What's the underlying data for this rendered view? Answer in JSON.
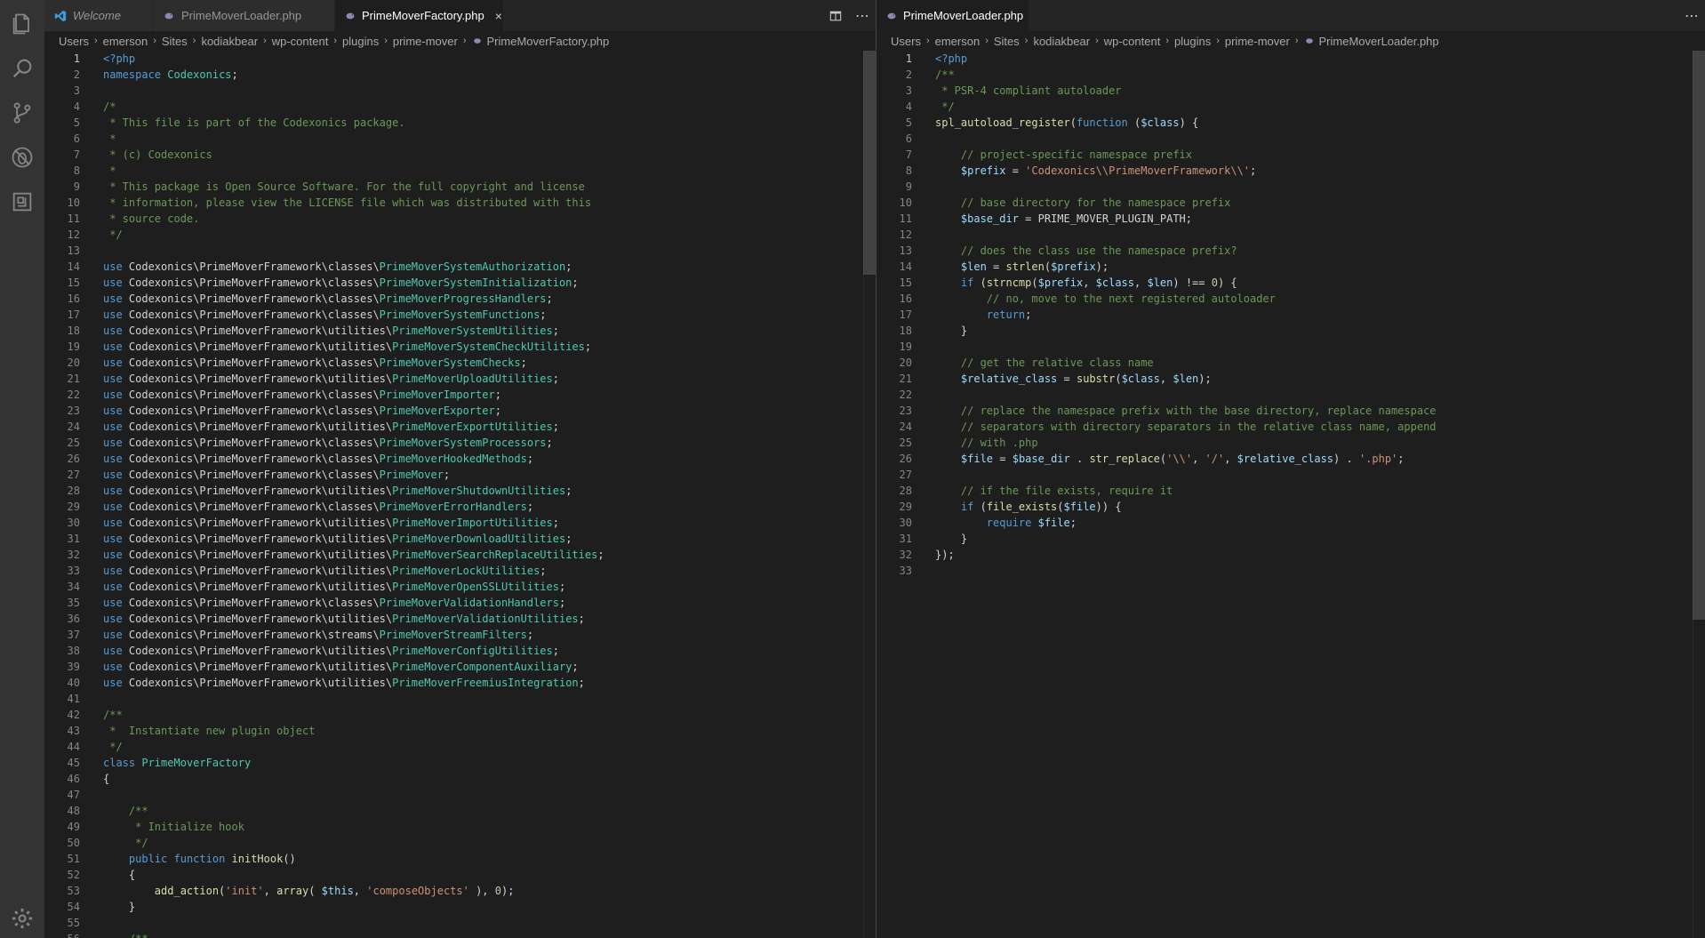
{
  "activity_bar": {
    "items": [
      "explorer-icon",
      "search-icon",
      "source-control-icon",
      "debug-icon",
      "extensions-icon"
    ],
    "bottom": "settings-gear-icon"
  },
  "left_group": {
    "tabs": [
      {
        "label": "Welcome",
        "icon": "vscode-icon",
        "active": false,
        "italic": true
      },
      {
        "label": "PrimeMoverLoader.php",
        "icon": "php-elephant-icon",
        "active": false
      },
      {
        "label": "PrimeMoverFactory.php",
        "icon": "php-elephant-icon",
        "active": true,
        "close": "×"
      }
    ],
    "actions": [
      "split-editor-icon",
      "more-actions-icon"
    ],
    "breadcrumb": [
      "Users",
      "emerson",
      "Sites",
      "kodiakbear",
      "wp-content",
      "plugins",
      "prime-mover",
      "PrimeMoverFactory.php"
    ],
    "current_line": 1
  },
  "right_group": {
    "tabs": [
      {
        "label": "PrimeMoverLoader.php",
        "icon": "php-elephant-icon",
        "active": true,
        "close": "×"
      }
    ],
    "actions": [
      "more-actions-icon"
    ],
    "breadcrumb": [
      "Users",
      "emerson",
      "Sites",
      "kodiakbear",
      "wp-content",
      "plugins",
      "prime-mover",
      "PrimeMoverLoader.php"
    ],
    "current_line": 1
  },
  "colors": {
    "keyword": "#569cd6",
    "comment": "#6a9955",
    "string": "#ce9178",
    "class": "#4ec9b0",
    "variable": "#9cdcfe",
    "function": "#dcdcaa"
  },
  "left_code": [
    [
      [
        "kw",
        "<?php"
      ]
    ],
    [
      [
        "kw",
        "namespace"
      ],
      [
        "",
        "",
        " "
      ],
      [
        "cls",
        "Codexonics"
      ],
      [
        "",
        ";"
      ]
    ],
    [],
    [
      [
        "cm",
        "/*"
      ]
    ],
    [
      [
        "cm",
        " * This file is part of the Codexonics package."
      ]
    ],
    [
      [
        "cm",
        " *"
      ]
    ],
    [
      [
        "cm",
        " * (c) Codexonics"
      ]
    ],
    [
      [
        "cm",
        " *"
      ]
    ],
    [
      [
        "cm",
        " * This package is Open Source Software. For the full copyright and license"
      ]
    ],
    [
      [
        "cm",
        " * information, please view the LICENSE file which was distributed with this"
      ]
    ],
    [
      [
        "cm",
        " * source code."
      ]
    ],
    [
      [
        "cm",
        " */"
      ]
    ],
    [],
    [
      [
        "kw",
        "use"
      ],
      [
        "",
        " Codexonics\\PrimeMoverFramework\\classes\\"
      ],
      [
        "cls",
        "PrimeMoverSystemAuthorization"
      ],
      [
        "",
        ";"
      ]
    ],
    [
      [
        "kw",
        "use"
      ],
      [
        "",
        " Codexonics\\PrimeMoverFramework\\classes\\"
      ],
      [
        "cls",
        "PrimeMoverSystemInitialization"
      ],
      [
        "",
        ";"
      ]
    ],
    [
      [
        "kw",
        "use"
      ],
      [
        "",
        " Codexonics\\PrimeMoverFramework\\classes\\"
      ],
      [
        "cls",
        "PrimeMoverProgressHandlers"
      ],
      [
        "",
        ";"
      ]
    ],
    [
      [
        "kw",
        "use"
      ],
      [
        "",
        " Codexonics\\PrimeMoverFramework\\classes\\"
      ],
      [
        "cls",
        "PrimeMoverSystemFunctions"
      ],
      [
        "",
        ";"
      ]
    ],
    [
      [
        "kw",
        "use"
      ],
      [
        "",
        " Codexonics\\PrimeMoverFramework\\utilities\\"
      ],
      [
        "cls",
        "PrimeMoverSystemUtilities"
      ],
      [
        "",
        ";"
      ]
    ],
    [
      [
        "kw",
        "use"
      ],
      [
        "",
        " Codexonics\\PrimeMoverFramework\\utilities\\"
      ],
      [
        "cls",
        "PrimeMoverSystemCheckUtilities"
      ],
      [
        "",
        ";"
      ]
    ],
    [
      [
        "kw",
        "use"
      ],
      [
        "",
        " Codexonics\\PrimeMoverFramework\\classes\\"
      ],
      [
        "cls",
        "PrimeMoverSystemChecks"
      ],
      [
        "",
        ";"
      ]
    ],
    [
      [
        "kw",
        "use"
      ],
      [
        "",
        " Codexonics\\PrimeMoverFramework\\utilities\\"
      ],
      [
        "cls",
        "PrimeMoverUploadUtilities"
      ],
      [
        "",
        ";"
      ]
    ],
    [
      [
        "kw",
        "use"
      ],
      [
        "",
        " Codexonics\\PrimeMoverFramework\\classes\\"
      ],
      [
        "cls",
        "PrimeMoverImporter"
      ],
      [
        "",
        ";"
      ]
    ],
    [
      [
        "kw",
        "use"
      ],
      [
        "",
        " Codexonics\\PrimeMoverFramework\\classes\\"
      ],
      [
        "cls",
        "PrimeMoverExporter"
      ],
      [
        "",
        ";"
      ]
    ],
    [
      [
        "kw",
        "use"
      ],
      [
        "",
        " Codexonics\\PrimeMoverFramework\\utilities\\"
      ],
      [
        "cls",
        "PrimeMoverExportUtilities"
      ],
      [
        "",
        ";"
      ]
    ],
    [
      [
        "kw",
        "use"
      ],
      [
        "",
        " Codexonics\\PrimeMoverFramework\\classes\\"
      ],
      [
        "cls",
        "PrimeMoverSystemProcessors"
      ],
      [
        "",
        ";"
      ]
    ],
    [
      [
        "kw",
        "use"
      ],
      [
        "",
        " Codexonics\\PrimeMoverFramework\\classes\\"
      ],
      [
        "cls",
        "PrimeMoverHookedMethods"
      ],
      [
        "",
        ";"
      ]
    ],
    [
      [
        "kw",
        "use"
      ],
      [
        "",
        " Codexonics\\PrimeMoverFramework\\classes\\"
      ],
      [
        "cls",
        "PrimeMover"
      ],
      [
        "",
        ";"
      ]
    ],
    [
      [
        "kw",
        "use"
      ],
      [
        "",
        " Codexonics\\PrimeMoverFramework\\utilities\\"
      ],
      [
        "cls",
        "PrimeMoverShutdownUtilities"
      ],
      [
        "",
        ";"
      ]
    ],
    [
      [
        "kw",
        "use"
      ],
      [
        "",
        " Codexonics\\PrimeMoverFramework\\classes\\"
      ],
      [
        "cls",
        "PrimeMoverErrorHandlers"
      ],
      [
        "",
        ";"
      ]
    ],
    [
      [
        "kw",
        "use"
      ],
      [
        "",
        " Codexonics\\PrimeMoverFramework\\utilities\\"
      ],
      [
        "cls",
        "PrimeMoverImportUtilities"
      ],
      [
        "",
        ";"
      ]
    ],
    [
      [
        "kw",
        "use"
      ],
      [
        "",
        " Codexonics\\PrimeMoverFramework\\utilities\\"
      ],
      [
        "cls",
        "PrimeMoverDownloadUtilities"
      ],
      [
        "",
        ";"
      ]
    ],
    [
      [
        "kw",
        "use"
      ],
      [
        "",
        " Codexonics\\PrimeMoverFramework\\utilities\\"
      ],
      [
        "cls",
        "PrimeMoverSearchReplaceUtilities"
      ],
      [
        "",
        ";"
      ]
    ],
    [
      [
        "kw",
        "use"
      ],
      [
        "",
        " Codexonics\\PrimeMoverFramework\\utilities\\"
      ],
      [
        "cls",
        "PrimeMoverLockUtilities"
      ],
      [
        "",
        ";"
      ]
    ],
    [
      [
        "kw",
        "use"
      ],
      [
        "",
        " Codexonics\\PrimeMoverFramework\\utilities\\"
      ],
      [
        "cls",
        "PrimeMoverOpenSSLUtilities"
      ],
      [
        "",
        ";"
      ]
    ],
    [
      [
        "kw",
        "use"
      ],
      [
        "",
        " Codexonics\\PrimeMoverFramework\\classes\\"
      ],
      [
        "cls",
        "PrimeMoverValidationHandlers"
      ],
      [
        "",
        ";"
      ]
    ],
    [
      [
        "kw",
        "use"
      ],
      [
        "",
        " Codexonics\\PrimeMoverFramework\\utilities\\"
      ],
      [
        "cls",
        "PrimeMoverValidationUtilities"
      ],
      [
        "",
        ";"
      ]
    ],
    [
      [
        "kw",
        "use"
      ],
      [
        "",
        " Codexonics\\PrimeMoverFramework\\streams\\"
      ],
      [
        "cls",
        "PrimeMoverStreamFilters"
      ],
      [
        "",
        ";"
      ]
    ],
    [
      [
        "kw",
        "use"
      ],
      [
        "",
        " Codexonics\\PrimeMoverFramework\\utilities\\"
      ],
      [
        "cls",
        "PrimeMoverConfigUtilities"
      ],
      [
        "",
        ";"
      ]
    ],
    [
      [
        "kw",
        "use"
      ],
      [
        "",
        " Codexonics\\PrimeMoverFramework\\utilities\\"
      ],
      [
        "cls",
        "PrimeMoverComponentAuxiliary"
      ],
      [
        "",
        ";"
      ]
    ],
    [
      [
        "kw",
        "use"
      ],
      [
        "",
        " Codexonics\\PrimeMoverFramework\\utilities\\"
      ],
      [
        "cls",
        "PrimeMoverFreemiusIntegration"
      ],
      [
        "",
        ";"
      ]
    ],
    [],
    [
      [
        "cm",
        "/**"
      ]
    ],
    [
      [
        "cm",
        " *  Instantiate new plugin object"
      ]
    ],
    [
      [
        "cm",
        " */"
      ]
    ],
    [
      [
        "kw",
        "class"
      ],
      [
        "",
        " "
      ],
      [
        "cls",
        "PrimeMoverFactory"
      ]
    ],
    [
      [
        "",
        "{"
      ]
    ],
    [],
    [
      [
        "",
        "    "
      ],
      [
        "cm",
        "/**"
      ]
    ],
    [
      [
        "",
        "    "
      ],
      [
        "cm",
        " * Initialize hook"
      ]
    ],
    [
      [
        "",
        "    "
      ],
      [
        "cm",
        " */"
      ]
    ],
    [
      [
        "",
        "    "
      ],
      [
        "kw",
        "public"
      ],
      [
        "",
        " "
      ],
      [
        "kw",
        "function"
      ],
      [
        "",
        " "
      ],
      [
        "fn",
        "initHook"
      ],
      [
        "",
        "()"
      ]
    ],
    [
      [
        "",
        "    {"
      ]
    ],
    [
      [
        "",
        "        "
      ],
      [
        "fn",
        "add_action"
      ],
      [
        "",
        "("
      ],
      [
        "st",
        "'init'"
      ],
      [
        "",
        ", "
      ],
      [
        "fn",
        "array"
      ],
      [
        "",
        "( "
      ],
      [
        "var",
        "$this"
      ],
      [
        "",
        ", "
      ],
      [
        "st",
        "'composeObjects'"
      ],
      [
        "",
        " ), "
      ],
      [
        "num",
        "0"
      ],
      [
        "",
        ");"
      ]
    ],
    [
      [
        "",
        "    }"
      ]
    ],
    [],
    [
      [
        "",
        "    "
      ],
      [
        "cm",
        "/**"
      ]
    ]
  ],
  "right_code": [
    [
      [
        "kw",
        "<?php"
      ]
    ],
    [
      [
        "cm",
        "/**"
      ]
    ],
    [
      [
        "cm",
        " * PSR-4 compliant autoloader"
      ]
    ],
    [
      [
        "cm",
        " */"
      ]
    ],
    [
      [
        "fn",
        "spl_autoload_register"
      ],
      [
        "",
        "("
      ],
      [
        "kw",
        "function"
      ],
      [
        "",
        " ("
      ],
      [
        "var",
        "$class"
      ],
      [
        "",
        ") {"
      ]
    ],
    [],
    [
      [
        "",
        "    "
      ],
      [
        "cm",
        "// project-specific namespace prefix"
      ]
    ],
    [
      [
        "",
        "    "
      ],
      [
        "var",
        "$prefix"
      ],
      [
        "",
        " = "
      ],
      [
        "st",
        "'Codexonics\\\\PrimeMoverFramework\\\\'"
      ],
      [
        "",
        ";"
      ]
    ],
    [],
    [
      [
        "",
        "    "
      ],
      [
        "cm",
        "// base directory for the namespace prefix"
      ]
    ],
    [
      [
        "",
        "    "
      ],
      [
        "var",
        "$base_dir"
      ],
      [
        "",
        " = PRIME_MOVER_PLUGIN_PATH;"
      ]
    ],
    [],
    [
      [
        "",
        "    "
      ],
      [
        "cm",
        "// does the class use the namespace prefix?"
      ]
    ],
    [
      [
        "",
        "    "
      ],
      [
        "var",
        "$len"
      ],
      [
        "",
        " = "
      ],
      [
        "fn",
        "strlen"
      ],
      [
        "",
        "("
      ],
      [
        "var",
        "$prefix"
      ],
      [
        "",
        ");"
      ]
    ],
    [
      [
        "",
        "    "
      ],
      [
        "kw",
        "if"
      ],
      [
        "",
        " ("
      ],
      [
        "fn",
        "strncmp"
      ],
      [
        "",
        "("
      ],
      [
        "var",
        "$prefix"
      ],
      [
        "",
        ", "
      ],
      [
        "var",
        "$class"
      ],
      [
        "",
        ", "
      ],
      [
        "var",
        "$len"
      ],
      [
        "",
        ") !== "
      ],
      [
        "num",
        "0"
      ],
      [
        "",
        ") {"
      ]
    ],
    [
      [
        "",
        "        "
      ],
      [
        "cm",
        "// no, move to the next registered autoloader"
      ]
    ],
    [
      [
        "",
        "        "
      ],
      [
        "kw",
        "return"
      ],
      [
        "",
        ";"
      ]
    ],
    [
      [
        "",
        "    }"
      ]
    ],
    [],
    [
      [
        "",
        "    "
      ],
      [
        "cm",
        "// get the relative class name"
      ]
    ],
    [
      [
        "",
        "    "
      ],
      [
        "var",
        "$relative_class"
      ],
      [
        "",
        " = "
      ],
      [
        "fn",
        "substr"
      ],
      [
        "",
        "("
      ],
      [
        "var",
        "$class"
      ],
      [
        "",
        ", "
      ],
      [
        "var",
        "$len"
      ],
      [
        "",
        ");"
      ]
    ],
    [],
    [
      [
        "",
        "    "
      ],
      [
        "cm",
        "// replace the namespace prefix with the base directory, replace namespace"
      ]
    ],
    [
      [
        "",
        "    "
      ],
      [
        "cm",
        "// separators with directory separators in the relative class name, append"
      ]
    ],
    [
      [
        "",
        "    "
      ],
      [
        "cm",
        "// with .php"
      ]
    ],
    [
      [
        "",
        "    "
      ],
      [
        "var",
        "$file"
      ],
      [
        "",
        " = "
      ],
      [
        "var",
        "$base_dir"
      ],
      [
        "",
        " . "
      ],
      [
        "fn",
        "str_replace"
      ],
      [
        "",
        "("
      ],
      [
        "st",
        "'\\\\'"
      ],
      [
        "",
        ", "
      ],
      [
        "st",
        "'/'"
      ],
      [
        "",
        ", "
      ],
      [
        "var",
        "$relative_class"
      ],
      [
        "",
        ") . "
      ],
      [
        "st",
        "'.php'"
      ],
      [
        "",
        ";"
      ]
    ],
    [],
    [
      [
        "",
        "    "
      ],
      [
        "cm",
        "// if the file exists, require it"
      ]
    ],
    [
      [
        "",
        "    "
      ],
      [
        "kw",
        "if"
      ],
      [
        "",
        " ("
      ],
      [
        "fn",
        "file_exists"
      ],
      [
        "",
        "("
      ],
      [
        "var",
        "$file"
      ],
      [
        "",
        ")) {"
      ]
    ],
    [
      [
        "",
        "        "
      ],
      [
        "kw",
        "require"
      ],
      [
        "",
        " "
      ],
      [
        "var",
        "$file"
      ],
      [
        "",
        ";"
      ]
    ],
    [
      [
        "",
        "    }"
      ]
    ],
    [
      [
        "",
        "});"
      ]
    ],
    []
  ]
}
